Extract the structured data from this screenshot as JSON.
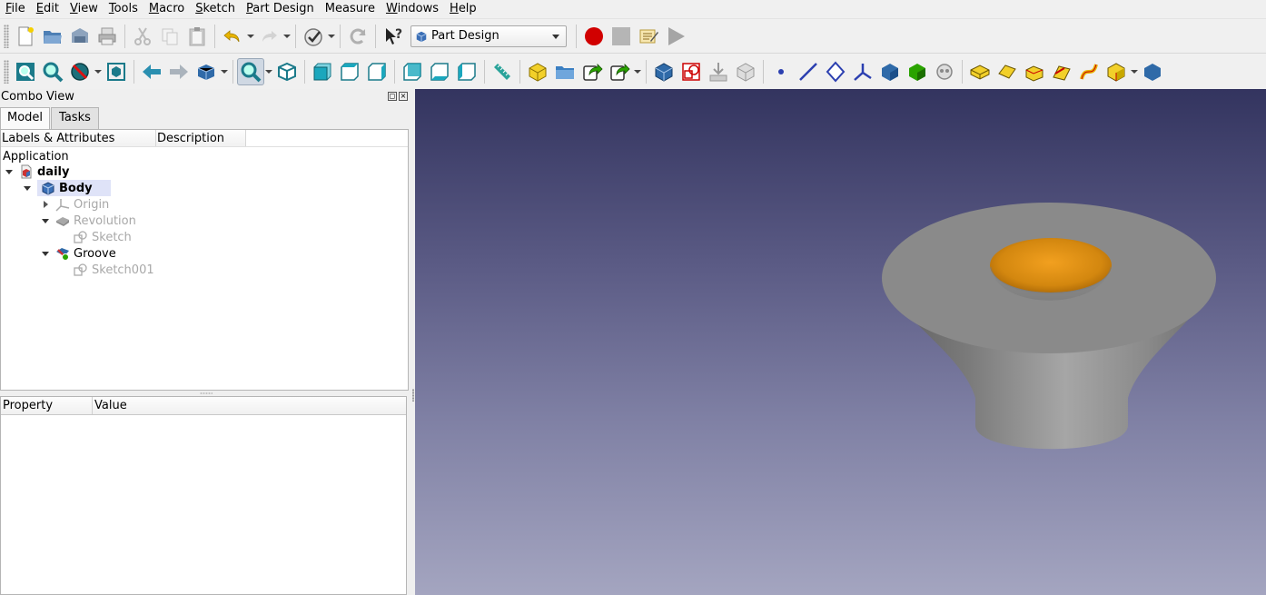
{
  "menu": {
    "items": [
      {
        "label": "File",
        "key": "F",
        "rest": "ile"
      },
      {
        "label": "Edit",
        "key": "E",
        "rest": "dit"
      },
      {
        "label": "View",
        "key": "V",
        "rest": "iew"
      },
      {
        "label": "Tools",
        "key": "T",
        "rest": "ools"
      },
      {
        "label": "Macro",
        "key": "M",
        "rest": "acro"
      },
      {
        "label": "Sketch",
        "key": "S",
        "rest": "ketch"
      },
      {
        "label": "Part Design",
        "key": "P",
        "rest": "art Design"
      },
      {
        "label": "Measure",
        "key": "",
        "rest": "Measure"
      },
      {
        "label": "Windows",
        "key": "W",
        "rest": "indows"
      },
      {
        "label": "Help",
        "key": "H",
        "rest": "elp"
      }
    ]
  },
  "toolbar": {
    "workbench": "Part Design"
  },
  "combo": {
    "title": "Combo View",
    "tabs": [
      "Model",
      "Tasks"
    ],
    "tree_columns": [
      "Labels & Attributes",
      "Description"
    ],
    "application_label": "Application",
    "tree": [
      {
        "label": "daily"
      },
      {
        "label": "Body"
      },
      {
        "label": "Origin"
      },
      {
        "label": "Revolution"
      },
      {
        "label": "Sketch"
      },
      {
        "label": "Groove"
      },
      {
        "label": "Sketch001"
      }
    ],
    "property_columns": [
      "Property",
      "Value"
    ]
  },
  "colors": {
    "viewport_top": "#33345f",
    "viewport_bottom": "#a4a5c0",
    "model_grey": "#8a8a8a",
    "groove_orange": "#e0901c",
    "record_red": "#d10000",
    "selection": "#dfe3f8"
  }
}
